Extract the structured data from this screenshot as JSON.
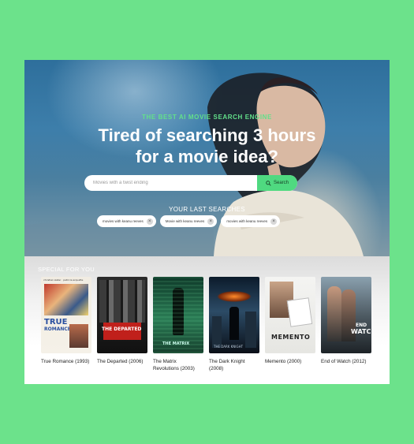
{
  "hero": {
    "eyebrow": "THE BEST AI MOVIE SEARCH ENGINE",
    "headline_line1": "Tired of searching 3 hours",
    "headline_line2": "for a movie idea?"
  },
  "search": {
    "placeholder": "Movies with a twist ending",
    "button_label": "Search",
    "button_icon": "search-icon",
    "accent_color": "#4fd980"
  },
  "last_searches": {
    "title": "YOUR LAST SEARCHES",
    "items": [
      {
        "label": "movies with keanu reeves"
      },
      {
        "label": "Movie with keanu reeves"
      },
      {
        "label": "movies with keanu reeves"
      }
    ]
  },
  "special": {
    "title": "SPECIAL FOR YOU",
    "movies": [
      {
        "title": "True Romance (1993)"
      },
      {
        "title": "The Departed (2006)"
      },
      {
        "title": "The Matrix Revolutions (2003)"
      },
      {
        "title": "The Dark Knight (2008)"
      },
      {
        "title": "Memento (2000)"
      },
      {
        "title": "End of Watch (2012)"
      }
    ]
  },
  "posters": {
    "p1_names": "christian slater · patricia arquette",
    "p1_line1": "TRUE",
    "p1_line2": "ROMANCE",
    "p2_text": "THE DEPARTED",
    "p3_text": "THE MATRIX",
    "p4_text": "THE DARK KNIGHT",
    "p5_text": "MEMENTO",
    "p6_line1": "END",
    "p6_line2": "WATCH"
  },
  "colors": {
    "page_background": "#6ce28b",
    "eyebrow": "#62e08a"
  }
}
